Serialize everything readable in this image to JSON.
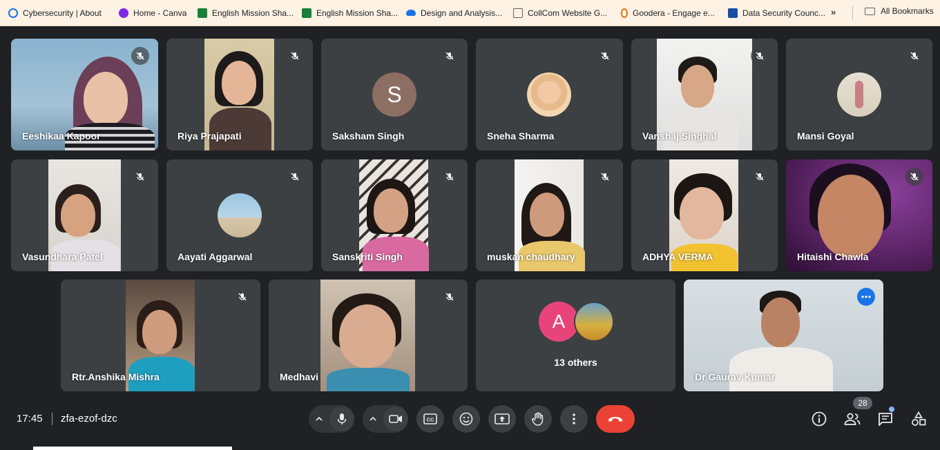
{
  "bookmarks": [
    {
      "label": "Cybersecurity | About",
      "icon": "cyber-icon",
      "color": "#1a73e8"
    },
    {
      "label": "Home - Canva",
      "icon": "canva-icon",
      "color": "#7d2ae8"
    },
    {
      "label": "English Mission Sha...",
      "icon": "sheets-icon",
      "color": "#188038"
    },
    {
      "label": "English Mission Sha...",
      "icon": "sheets-icon",
      "color": "#188038"
    },
    {
      "label": "Design and Analysis...",
      "icon": "cloud-icon",
      "color": "#1a73e8"
    },
    {
      "label": "CollCom Website G...",
      "icon": "collcom-icon",
      "color": "#5f6368"
    },
    {
      "label": "Goodera - Engage e...",
      "icon": "goodera-icon",
      "color": "#e8710a"
    },
    {
      "label": "Data Security Counc...",
      "icon": "dsci-icon",
      "color": "#174ea6"
    }
  ],
  "bookmarks_more": "»",
  "all_bookmarks": "All Bookmarks",
  "participants": [
    "Eeshikaa Kapoor",
    "Riya Prajapati",
    "Saksham Singh",
    "Sneha Sharma",
    "Vanshaj Singhal",
    "Mansi Goyal",
    "Vasundhara Patel",
    "Aayati Aggarwal",
    "Sanskriti Singh",
    "muskan chaudhary",
    "ADHYA VERMA",
    "Hitaishi Chawla",
    "Rtr.Anshika Mishra",
    "Medhavi",
    "Dr Gaurav Kumar"
  ],
  "avatar_letters": {
    "saksham": "S",
    "others": "A"
  },
  "others_label": "13 others",
  "colors": {
    "saksham_avatar": "#8d6e63",
    "others_avatar": "#e8447a",
    "active_border": "#8ab4f8",
    "end_call": "#ea4335"
  },
  "meeting": {
    "time": "17:45",
    "code": "zfa-ezof-dzc"
  },
  "people_count": "28"
}
